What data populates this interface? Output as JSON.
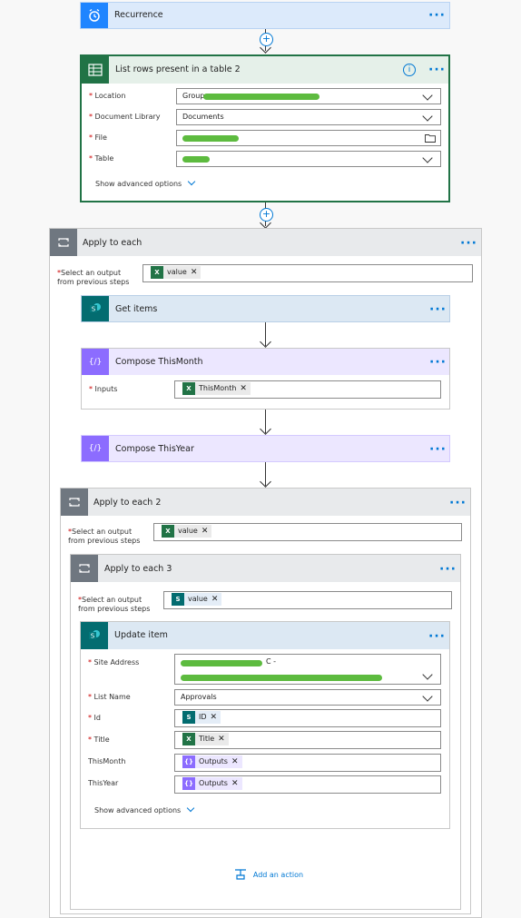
{
  "colors": {
    "accent": "#0078d4",
    "excel": "#217346",
    "sharepoint": "#036c70",
    "compose": "#8c6cff",
    "control": "#6f7780"
  },
  "icons": {
    "recurrence": "alarm-clock-icon",
    "excel": "excel-icon",
    "sharepoint": "sharepoint-icon",
    "compose": "compose-braces-icon",
    "loop": "loop-arrows-icon"
  },
  "recurrence": {
    "title": "Recurrence"
  },
  "list_rows": {
    "title": "List rows present in a table 2",
    "fields": [
      {
        "label": "Location",
        "value": "Group"
      },
      {
        "label": "Document Library",
        "value": "Documents"
      },
      {
        "label": "File",
        "value": ""
      },
      {
        "label": "Table",
        "value": ""
      }
    ],
    "advanced": "Show advanced options"
  },
  "apply1": {
    "title": "Apply to each",
    "select_label_1": "Select an output",
    "select_label_2": "from previous steps",
    "token": "value"
  },
  "get_items": {
    "title": "Get items"
  },
  "compose_month": {
    "title": "Compose ThisMonth",
    "inputs_label": "Inputs",
    "token": "ThisMonth"
  },
  "compose_year": {
    "title": "Compose ThisYear"
  },
  "apply2": {
    "title": "Apply to each 2",
    "select_label_1": "Select an output",
    "select_label_2": "from previous steps",
    "token": "value"
  },
  "apply3": {
    "title": "Apply to each 3",
    "select_label_1": "Select an output",
    "select_label_2": "from previous steps",
    "token": "value"
  },
  "update_item": {
    "title": "Update item",
    "site_label": "Site Address",
    "site_value_suffix": "C -",
    "list_label": "List Name",
    "list_value": "Approvals",
    "id_label": "Id",
    "id_token": "ID",
    "title_label": "Title",
    "title_token": "Title",
    "month_label": "ThisMonth",
    "month_token": "Outputs",
    "year_label": "ThisYear",
    "year_token": "Outputs",
    "advanced": "Show advanced options"
  },
  "add_action": "Add an action",
  "dots": "···",
  "info": "i",
  "plus": "+",
  "req": "*",
  "x": "✕"
}
